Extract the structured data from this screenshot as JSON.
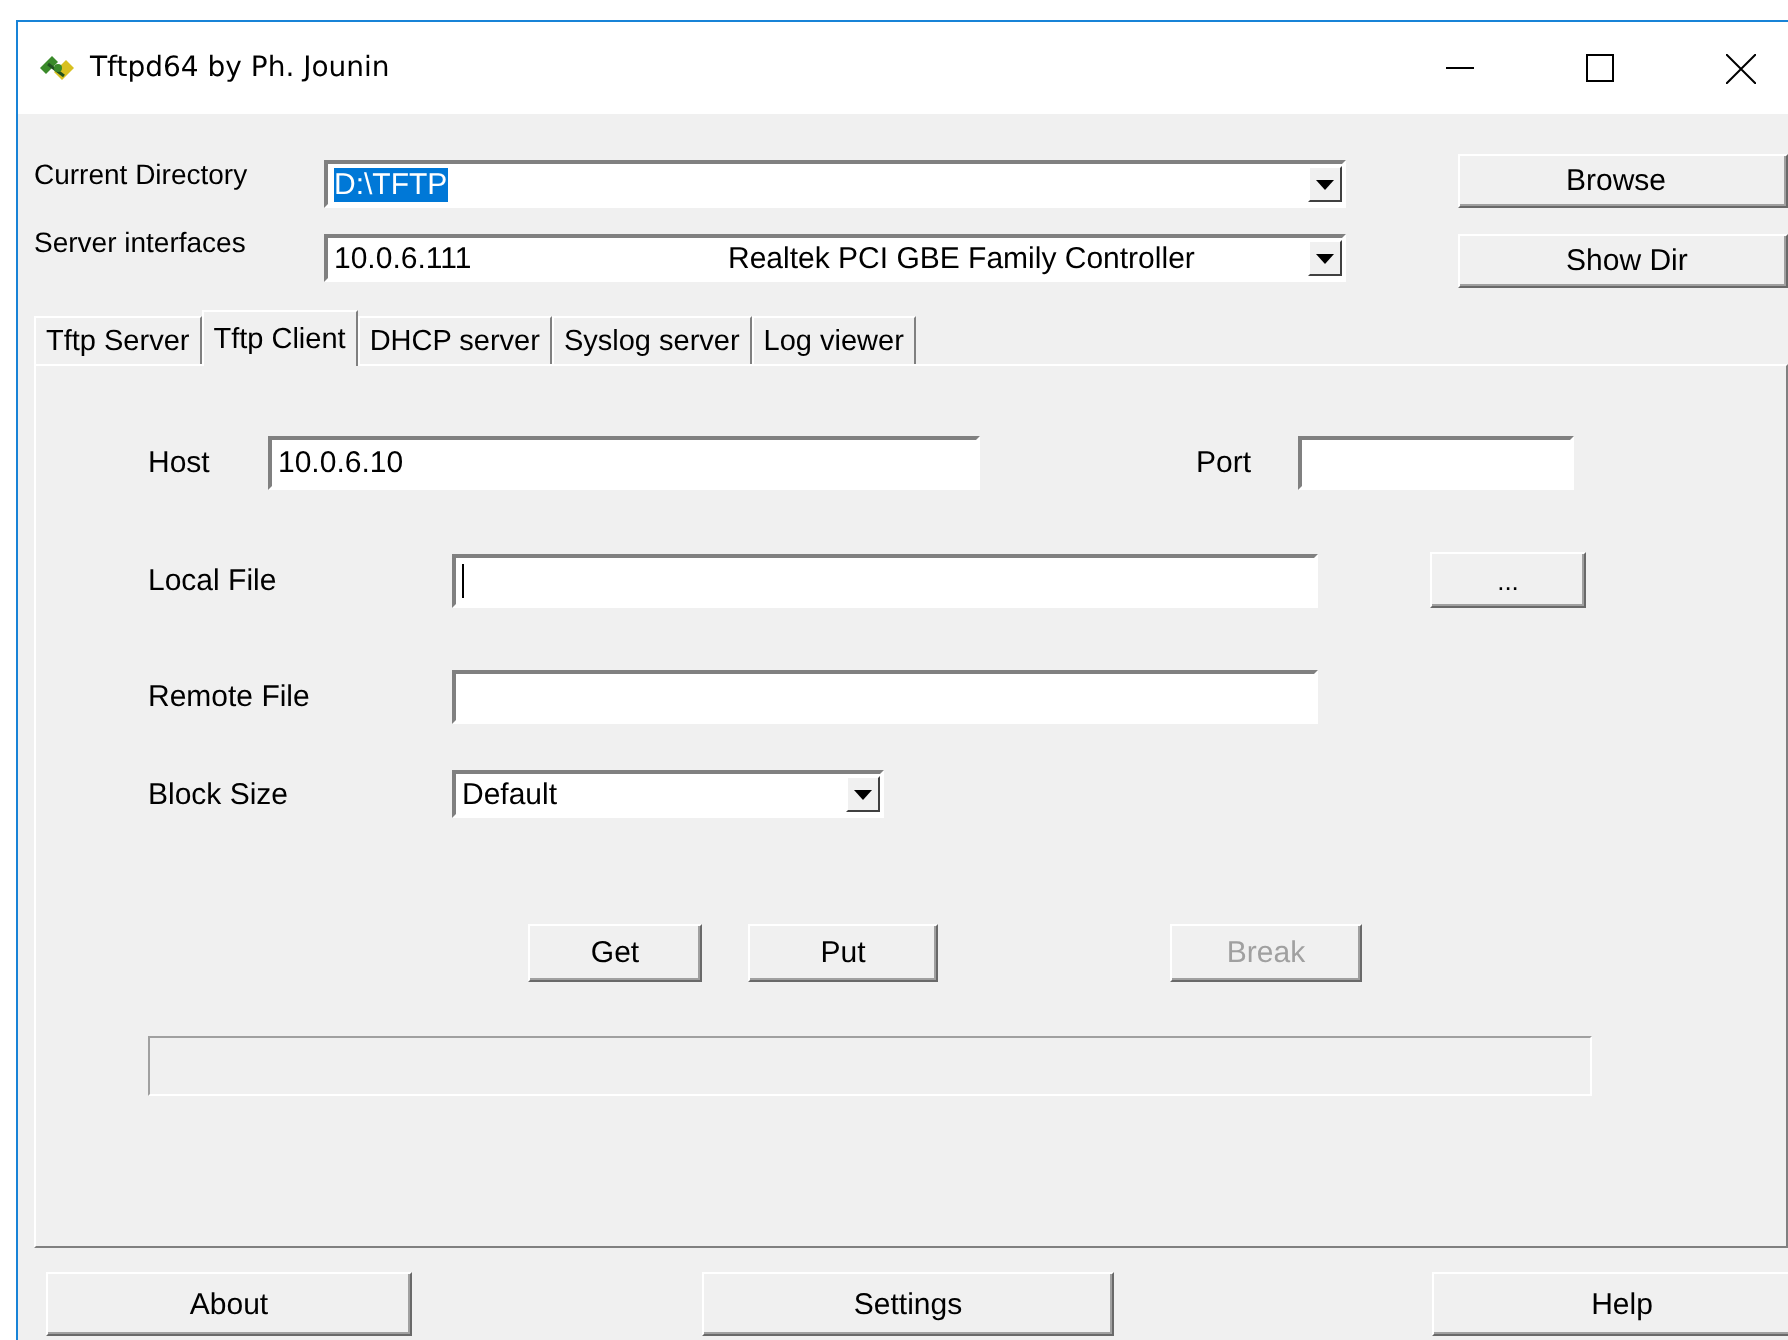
{
  "window": {
    "title": "Tftpd64 by Ph. Jounin"
  },
  "current_directory": {
    "label": "Current Directory",
    "value": "D:\\TFTP",
    "selected": true
  },
  "server_interfaces": {
    "label": "Server interfaces",
    "address": "10.0.6.111",
    "adapter": "Realtek PCI GBE Family Controller"
  },
  "side_buttons": [
    {
      "label": "Browse"
    },
    {
      "label": "Show Dir"
    }
  ],
  "tabs": [
    {
      "label": "Tftp Server",
      "selected": false
    },
    {
      "label": "Tftp Client",
      "selected": true
    },
    {
      "label": "DHCP server",
      "selected": false
    },
    {
      "label": "Syslog server",
      "selected": false
    },
    {
      "label": "Log viewer",
      "selected": false
    }
  ],
  "client": {
    "host_label": "Host",
    "host": "10.0.6.10",
    "port_label": "Port",
    "local_file_label": "Local File",
    "browse_button": "...",
    "remote_file_label": "Remote File",
    "block_size_label": "Block Size",
    "block_size": "Default"
  },
  "actions": [
    {
      "label": "Get",
      "disabled": false
    },
    {
      "label": "Put",
      "disabled": false
    },
    {
      "label": "Break",
      "disabled": true
    }
  ],
  "progress": {
    "level": 0
  },
  "bottom_buttons": [
    {
      "label": "About"
    },
    {
      "label": "Settings"
    },
    {
      "label": "Help"
    }
  ]
}
